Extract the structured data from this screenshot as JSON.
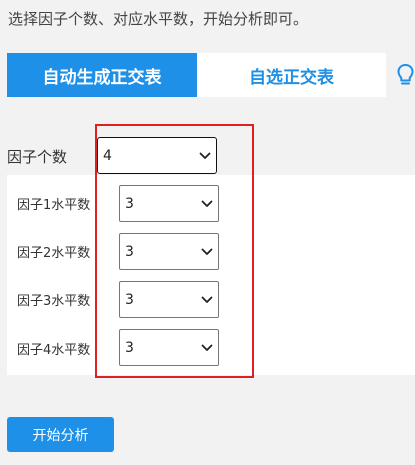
{
  "instruction": "选择因子个数、对应水平数，开始分析即可。",
  "tabs": [
    {
      "label": "自动生成正交表",
      "active": true
    },
    {
      "label": "自选正交表",
      "active": false
    }
  ],
  "hint_icon": "lightbulb-icon",
  "factor_count": {
    "label": "因子个数",
    "value": "4"
  },
  "levels": [
    {
      "label": "因子1水平数",
      "value": "3"
    },
    {
      "label": "因子2水平数",
      "value": "3"
    },
    {
      "label": "因子3水平数",
      "value": "3"
    },
    {
      "label": "因子4水平数",
      "value": "3"
    }
  ],
  "start_button": {
    "label": "开始分析"
  },
  "colors": {
    "accent": "#1e90e8",
    "highlight": "#e02020",
    "background": "#f2f2f2"
  }
}
